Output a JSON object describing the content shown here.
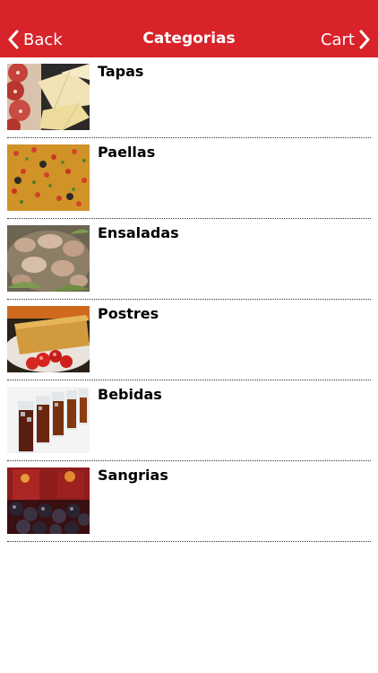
{
  "navbar": {
    "back_label": "Back",
    "title": "Categorias",
    "cart_label": "Cart",
    "background_color": "#d8232a"
  },
  "categories": [
    {
      "label": "Tapas",
      "icon": "tapas-photo"
    },
    {
      "label": "Paellas",
      "icon": "paella-photo"
    },
    {
      "label": "Ensaladas",
      "icon": "salad-photo"
    },
    {
      "label": "Postres",
      "icon": "dessert-photo"
    },
    {
      "label": "Bebidas",
      "icon": "drinks-photo"
    },
    {
      "label": "Sangrias",
      "icon": "sangria-photo"
    }
  ]
}
